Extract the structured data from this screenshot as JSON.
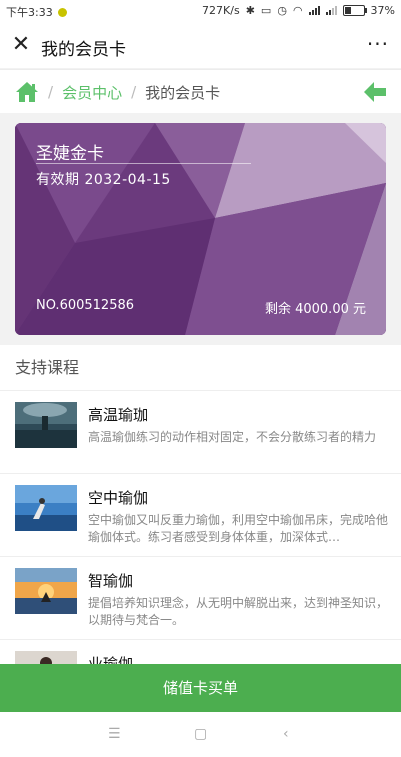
{
  "status": {
    "time": "下午3:33",
    "speed": "727K/s",
    "battery": "37%"
  },
  "titlebar": {
    "close_glyph": "✕",
    "title": "我的会员卡",
    "more_glyph": "···"
  },
  "breadcrumb": {
    "sep": "/",
    "member_center": "会员中心",
    "current": "我的会员卡"
  },
  "card": {
    "name": "圣婕金卡",
    "expiry": "有效期 2032-04-15",
    "number": "NO.600512586",
    "balance": "剩余 4000.00 元"
  },
  "courses": {
    "heading": "支持课程",
    "items": [
      {
        "name": "高温瑜珈",
        "desc": "高温瑜伽练习的动作相对固定，不会分散练习者的精力"
      },
      {
        "name": "空中瑜伽",
        "desc": "空中瑜伽又叫反重力瑜伽，利用空中瑜伽吊床，完成哈他瑜伽体式。练习者感受到身体体重，加深体式…"
      },
      {
        "name": "智瑜伽",
        "desc": "提倡培养知识理念，从无明中解脱出来，达到神圣知识，以期待与梵合一。"
      },
      {
        "name": "业瑜伽",
        "desc": ""
      }
    ]
  },
  "buy_button": {
    "label": "储值卡买单"
  },
  "colors": {
    "accent": "#4cae4f",
    "link": "#5cc06a",
    "card": "#6b3a7d"
  }
}
